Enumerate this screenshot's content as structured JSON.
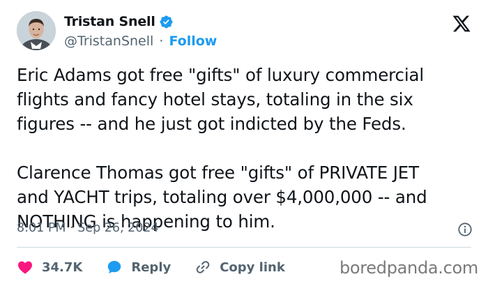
{
  "author": {
    "display_name": "Tristan Snell",
    "handle": "@TristanSnell",
    "separator": "·",
    "follow_label": "Follow"
  },
  "tweet": {
    "text": "Eric Adams got free \"gifts\" of luxury commercial\nflights and fancy hotel stays, totaling in the six\nfigures -- and he just got indicted by the Feds.\n\nClarence Thomas got free \"gifts\" of PRIVATE JET\nand YACHT trips, totaling over $4,000,000 -- and\nNOTHING is happening to him.",
    "timestamp": "8:01 PM · Sep 26, 2024"
  },
  "actions": {
    "like_count": "34.7K",
    "reply_label": "Reply",
    "copy_link_label": "Copy link"
  },
  "watermark": "boredpanda.com",
  "colors": {
    "accent": "#1d9bf0",
    "like": "#f91880",
    "secondary_text": "#536471",
    "primary_text": "#0f1419"
  },
  "icons": [
    "verified-badge-icon",
    "x-logo-icon",
    "info-icon",
    "heart-icon",
    "reply-bubble-icon",
    "link-icon"
  ]
}
